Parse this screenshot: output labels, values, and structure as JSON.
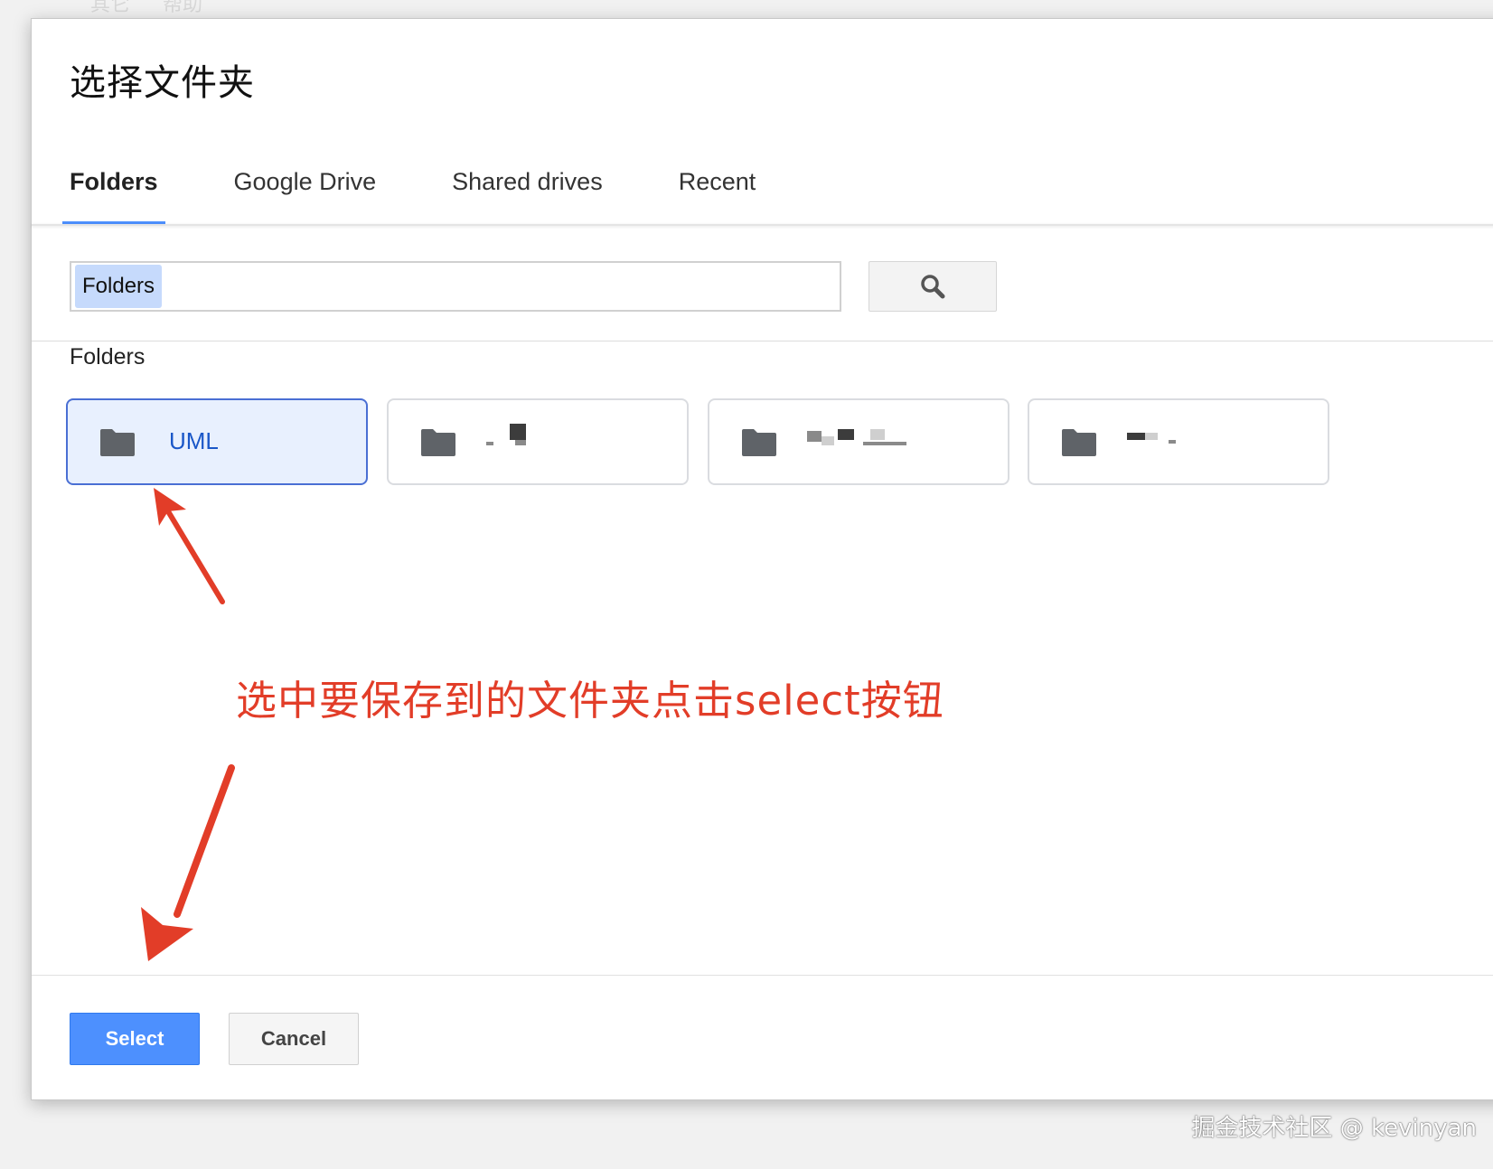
{
  "background_menu": [
    "其它",
    "帮助"
  ],
  "dialog": {
    "title": "选择文件夹",
    "tabs": [
      {
        "label": "Folders",
        "active": true
      },
      {
        "label": "Google Drive",
        "active": false
      },
      {
        "label": "Shared drives",
        "active": false
      },
      {
        "label": "Recent",
        "active": false
      }
    ],
    "search": {
      "chip_label": "Folders",
      "button_icon": "search-icon"
    },
    "section_label": "Folders",
    "folders": [
      {
        "name": "UML",
        "selected": true,
        "icon": "folder-icon"
      },
      {
        "name": "",
        "selected": false,
        "icon": "folder-icon",
        "obscured": true
      },
      {
        "name": "",
        "selected": false,
        "icon": "folder-icon",
        "obscured": true
      },
      {
        "name": "",
        "selected": false,
        "icon": "folder-icon",
        "obscured": true
      }
    ],
    "buttons": {
      "select_label": "Select",
      "cancel_label": "Cancel"
    }
  },
  "annotation": {
    "text": "选中要保存到的文件夹点击select按钮",
    "color": "#e23d28"
  },
  "watermark": "掘金技术社区 @ kevinyan",
  "colors": {
    "accent": "#4d90fe",
    "selected_card_bg": "#e8f0fe",
    "selected_card_border": "#4a6fd4",
    "folder_icon": "#5f6368"
  }
}
